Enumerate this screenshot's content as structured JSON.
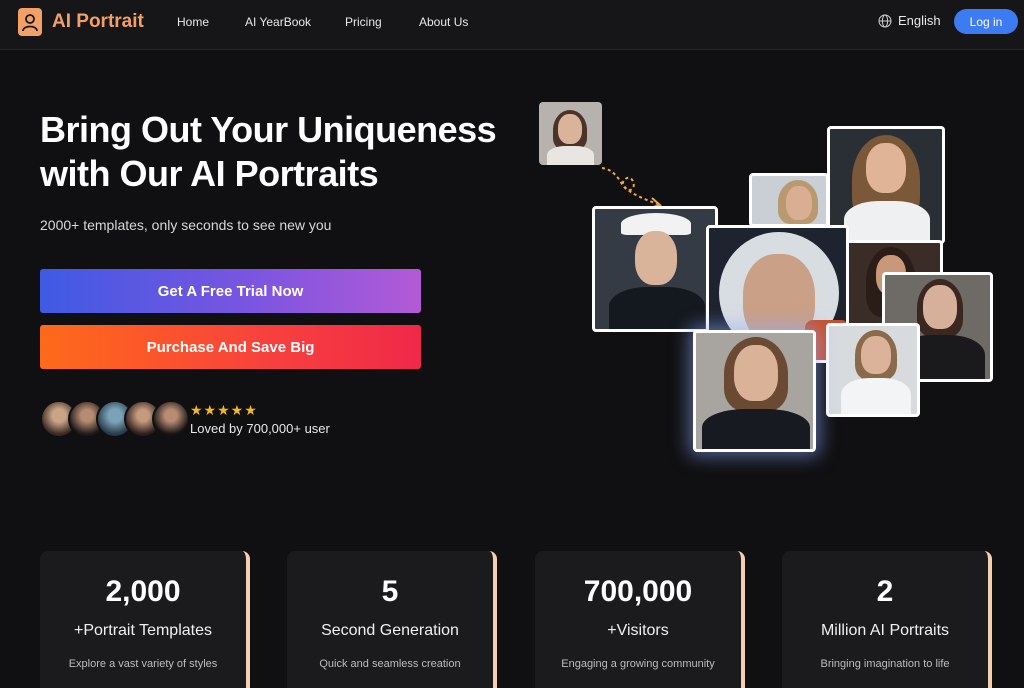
{
  "nav": {
    "logo": "AI Portrait",
    "links": [
      "Home",
      "AI YearBook",
      "Pricing",
      "About Us"
    ],
    "language": "English",
    "login": "Log in"
  },
  "hero": {
    "title_line1": "Bring Out Your Uniqueness",
    "title_line2": "with Our AI Portraits",
    "subtitle": "2000+ templates, only seconds to see new you",
    "trial_button": "Get A Free Trial Now",
    "purchase_button": "Purchase And Save Big",
    "rating_stars": "★★★★★",
    "loved_text": "Loved by 700,000+ user"
  },
  "stats": [
    {
      "number": "2,000",
      "label": "+Portrait Templates",
      "desc": "Explore a vast variety of styles"
    },
    {
      "number": "5",
      "label": "Second Generation",
      "desc": "Quick and seamless creation"
    },
    {
      "number": "700,000",
      "label": "+Visitors",
      "desc": "Engaging a growing community"
    },
    {
      "number": "2",
      "label": "Million AI Portraits",
      "desc": "Bringing imagination to life"
    }
  ],
  "colors": {
    "accent_orange": "#f2a066",
    "login_blue": "#3d7bf2",
    "star": "#f5b727"
  }
}
